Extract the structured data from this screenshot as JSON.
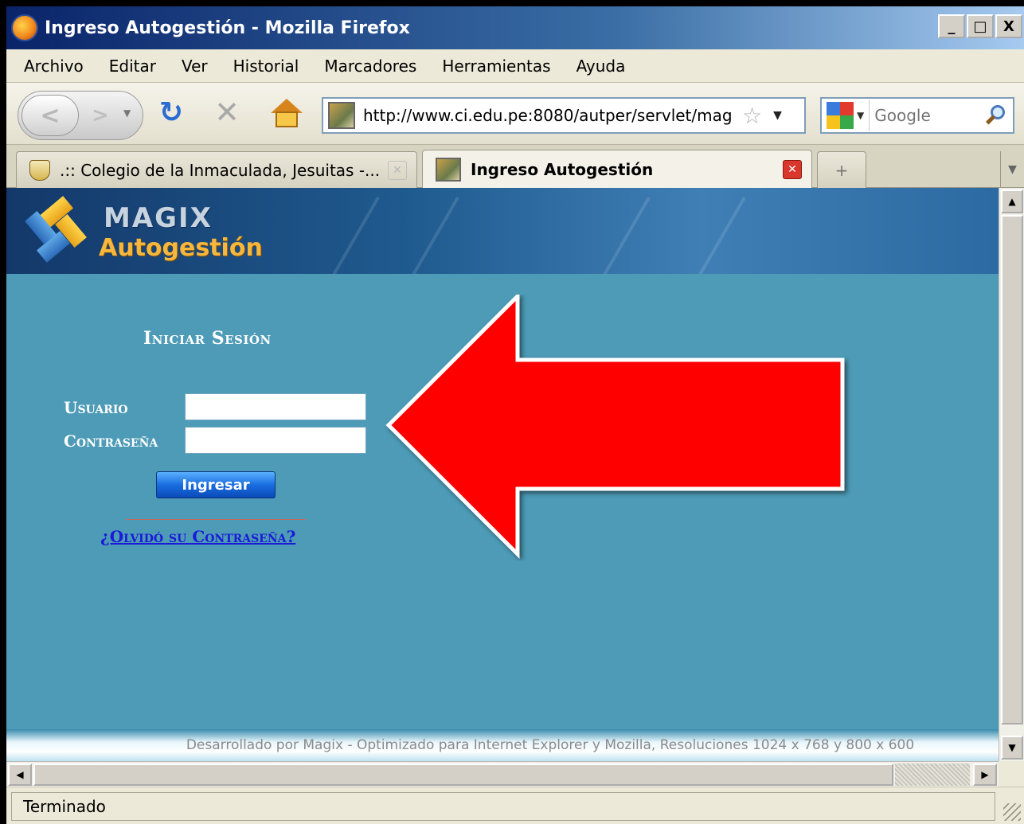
{
  "window": {
    "title": "Ingreso Autogestión - Mozilla Firefox",
    "buttons": {
      "minimize": "_",
      "maximize": "□",
      "close": "X"
    }
  },
  "menu": [
    "Archivo",
    "Editar",
    "Ver",
    "Historial",
    "Marcadores",
    "Herramientas",
    "Ayuda"
  ],
  "navbar": {
    "url": "http://www.ci.edu.pe:8080/autper/servlet/mag",
    "search_placeholder": "Google",
    "icons": [
      "back-arrow-icon",
      "forward-arrow-icon",
      "reload-icon",
      "stop-icon",
      "home-icon",
      "bookmark-star-icon",
      "google-icon",
      "magnifier-icon"
    ]
  },
  "tabs": [
    {
      "label": ".:: Colegio de la Inmaculada, Jesuitas -...",
      "active": false
    },
    {
      "label": "Ingreso Autogestión",
      "active": true
    }
  ],
  "page": {
    "brand": "MAGIX",
    "brand_sub": "Autogestión",
    "login_title": "Iniciar Sesión",
    "user_label": "Usuario",
    "password_label": "Contraseña",
    "user_value": "",
    "password_value": "",
    "submit_label": "Ingresar",
    "forgot_link": "¿Olvidó su Contraseña?",
    "footer": "Desarrollado por Magix - Optimizado para Internet Explorer y Mozilla, Resoluciones 1024 x 768 y 800 x 600"
  },
  "annotation": {
    "arrow_color": "#ff0000",
    "arrow_direction": "left"
  },
  "status": "Terminado",
  "colors": {
    "page_bg": "#4d9bb7",
    "header_bg": "#1f5a8e",
    "link": "#1a1ad8",
    "button": "#1a6ee0"
  }
}
